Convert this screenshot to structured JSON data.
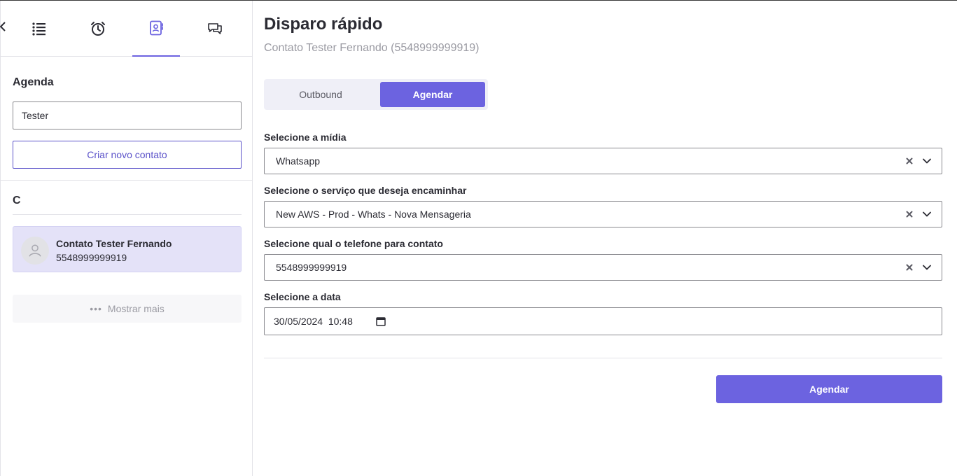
{
  "sidebar": {
    "tabs": [
      {
        "id": "list",
        "icon": "list-icon"
      },
      {
        "id": "alarm",
        "icon": "alarm-clock-icon"
      },
      {
        "id": "contacts",
        "icon": "contact-book-icon",
        "active": true
      },
      {
        "id": "chat",
        "icon": "chat-bubbles-icon"
      }
    ],
    "agenda_title": "Agenda",
    "search_value": "Tester",
    "create_contact_label": "Criar novo contato",
    "group_letter": "C",
    "contacts": [
      {
        "name": "Contato Tester Fernando",
        "phone": "5548999999919"
      }
    ],
    "show_more_label": "Mostrar mais"
  },
  "main": {
    "title": "Disparo rápido",
    "subtitle": "Contato Tester Fernando (5548999999919)",
    "segments": {
      "outbound": "Outbound",
      "agendar": "Agendar",
      "selected": "Agendar"
    },
    "fields": {
      "media": {
        "label": "Selecione a mídia",
        "value": "Whatsapp"
      },
      "service": {
        "label": "Selecione o serviço que deseja encaminhar",
        "value": "New AWS - Prod - Whats - Nova Mensageria"
      },
      "phone": {
        "label": "Selecione qual o telefone para contato",
        "value": "5548999999919"
      },
      "date": {
        "label": "Selecione a data",
        "value": "30/05/2024  10:48"
      }
    },
    "submit_label": "Agendar"
  },
  "colors": {
    "accent": "#6c63e0",
    "active_card": "#e4e2f8"
  }
}
